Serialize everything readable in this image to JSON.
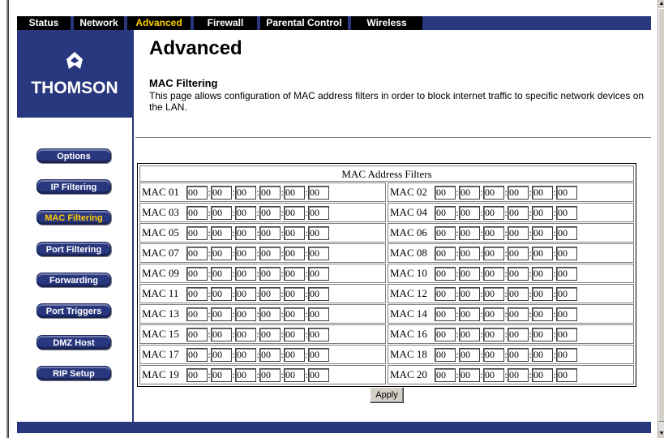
{
  "nav": {
    "tabs": [
      {
        "label": "Status"
      },
      {
        "label": "Network"
      },
      {
        "label": "Advanced"
      },
      {
        "label": "Firewall"
      },
      {
        "label": "Parental Control"
      },
      {
        "label": "Wireless"
      }
    ],
    "active_tab": "Advanced"
  },
  "brand": {
    "logo_text": "THOMSON",
    "logo_icon": "thomson-logo-icon"
  },
  "sidebar": {
    "items": [
      {
        "label": "Options"
      },
      {
        "label": "IP Filtering"
      },
      {
        "label": "MAC Filtering"
      },
      {
        "label": "Port Filtering"
      },
      {
        "label": "Forwarding"
      },
      {
        "label": "Port Triggers"
      },
      {
        "label": "DMZ Host"
      },
      {
        "label": "RIP Setup"
      }
    ],
    "active_item": "MAC Filtering"
  },
  "page": {
    "title": "Advanced",
    "section_title": "MAC Filtering",
    "description": "This page allows configuration of MAC address filters in order to block internet traffic to specific network devices on the LAN."
  },
  "filters": {
    "header": "MAC Address Filters",
    "entries": [
      {
        "label": "MAC 01",
        "octets": [
          "00",
          "00",
          "00",
          "00",
          "00",
          "00"
        ]
      },
      {
        "label": "MAC 02",
        "octets": [
          "00",
          "00",
          "00",
          "00",
          "00",
          "00"
        ]
      },
      {
        "label": "MAC 03",
        "octets": [
          "00",
          "00",
          "00",
          "00",
          "00",
          "00"
        ]
      },
      {
        "label": "MAC 04",
        "octets": [
          "00",
          "00",
          "00",
          "00",
          "00",
          "00"
        ]
      },
      {
        "label": "MAC 05",
        "octets": [
          "00",
          "00",
          "00",
          "00",
          "00",
          "00"
        ]
      },
      {
        "label": "MAC 06",
        "octets": [
          "00",
          "00",
          "00",
          "00",
          "00",
          "00"
        ]
      },
      {
        "label": "MAC 07",
        "octets": [
          "00",
          "00",
          "00",
          "00",
          "00",
          "00"
        ]
      },
      {
        "label": "MAC 08",
        "octets": [
          "00",
          "00",
          "00",
          "00",
          "00",
          "00"
        ]
      },
      {
        "label": "MAC 09",
        "octets": [
          "00",
          "00",
          "00",
          "00",
          "00",
          "00"
        ]
      },
      {
        "label": "MAC 10",
        "octets": [
          "00",
          "00",
          "00",
          "00",
          "00",
          "00"
        ]
      },
      {
        "label": "MAC 11",
        "octets": [
          "00",
          "00",
          "00",
          "00",
          "00",
          "00"
        ]
      },
      {
        "label": "MAC 12",
        "octets": [
          "00",
          "00",
          "00",
          "00",
          "00",
          "00"
        ]
      },
      {
        "label": "MAC 13",
        "octets": [
          "00",
          "00",
          "00",
          "00",
          "00",
          "00"
        ]
      },
      {
        "label": "MAC 14",
        "octets": [
          "00",
          "00",
          "00",
          "00",
          "00",
          "00"
        ]
      },
      {
        "label": "MAC 15",
        "octets": [
          "00",
          "00",
          "00",
          "00",
          "00",
          "00"
        ]
      },
      {
        "label": "MAC 16",
        "octets": [
          "00",
          "00",
          "00",
          "00",
          "00",
          "00"
        ]
      },
      {
        "label": "MAC 17",
        "octets": [
          "00",
          "00",
          "00",
          "00",
          "00",
          "00"
        ]
      },
      {
        "label": "MAC 18",
        "octets": [
          "00",
          "00",
          "00",
          "00",
          "00",
          "00"
        ]
      },
      {
        "label": "MAC 19",
        "octets": [
          "00",
          "00",
          "00",
          "00",
          "00",
          "00"
        ]
      },
      {
        "label": "MAC 20",
        "octets": [
          "00",
          "00",
          "00",
          "00",
          "00",
          "00"
        ]
      }
    ],
    "separator": ":",
    "apply_label": "Apply"
  },
  "colors": {
    "brand_blue": "#28377e",
    "active_text": "#ffcc00",
    "nav_bg": "#000000"
  }
}
